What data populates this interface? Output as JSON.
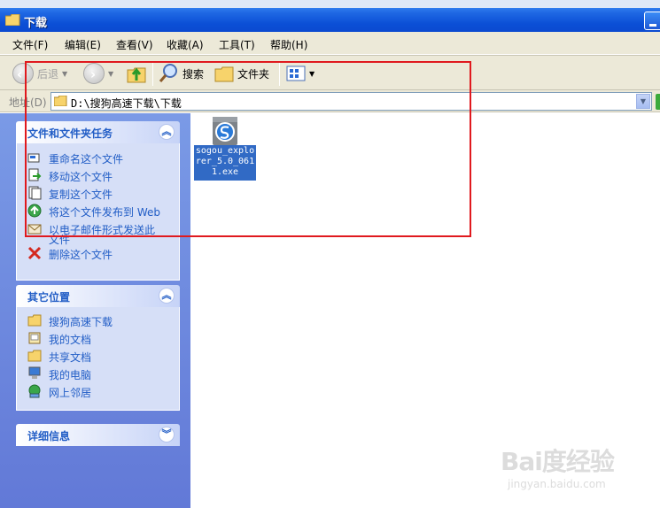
{
  "window": {
    "title": "下载"
  },
  "menu": [
    {
      "label": "文件(F)"
    },
    {
      "label": "编辑(E)"
    },
    {
      "label": "查看(V)"
    },
    {
      "label": "收藏(A)"
    },
    {
      "label": "工具(T)"
    },
    {
      "label": "帮助(H)"
    }
  ],
  "toolbar": {
    "back": "后退",
    "search": "搜索",
    "folders": "文件夹"
  },
  "address": {
    "label": "地址(D)",
    "path": "D:\\搜狗高速下载\\下载"
  },
  "file_tasks": {
    "title": "文件和文件夹任务",
    "items": [
      {
        "label": "重命名这个文件",
        "icon": "rename-icon"
      },
      {
        "label": "移动这个文件",
        "icon": "move-icon"
      },
      {
        "label": "复制这个文件",
        "icon": "copy-icon"
      },
      {
        "label": "将这个文件发布到 Web",
        "icon": "publish-web-icon"
      },
      {
        "label": "以电子邮件形式发送此",
        "label2": "文件",
        "icon": "email-icon"
      },
      {
        "label": "删除这个文件",
        "icon": "delete-icon"
      }
    ]
  },
  "other_places": {
    "title": "其它位置",
    "items": [
      {
        "label": "搜狗高速下载",
        "icon": "folder-icon"
      },
      {
        "label": "我的文档",
        "icon": "my-documents-icon"
      },
      {
        "label": "共享文档",
        "icon": "shared-folder-icon"
      },
      {
        "label": "我的电脑",
        "icon": "my-computer-icon"
      },
      {
        "label": "网上邻居",
        "icon": "network-icon"
      }
    ]
  },
  "details": {
    "title": "详细信息"
  },
  "file": {
    "name_line1": "sogou_explo",
    "name_line2": "rer_5.0_061",
    "name_line3": "1.exe"
  },
  "watermark": {
    "main": "Bai度经验",
    "sub": "jingyan.baidu.com"
  },
  "colors": {
    "title_bar": "#1f68e3",
    "task_pane": "#6e8ee0",
    "link_blue": "#215dc6",
    "selection": "#316ac5",
    "highlight_box": "#e0191e"
  }
}
